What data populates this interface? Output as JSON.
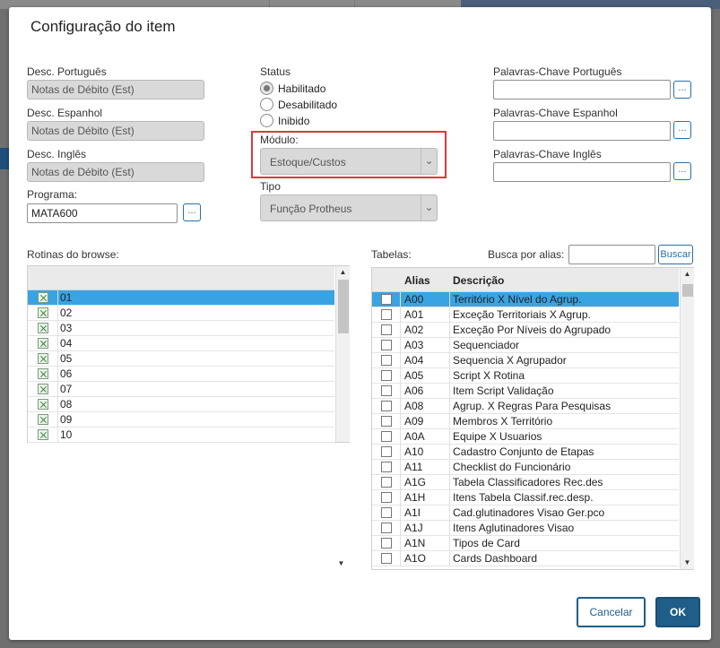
{
  "dialog": {
    "title": "Configuração do item"
  },
  "desc": {
    "pt_label": "Desc. Português",
    "pt_value": "Notas de Débito (Est)",
    "es_label": "Desc. Espanhol",
    "es_value": "Notas de Débito (Est)",
    "en_label": "Desc. Inglês",
    "en_value": "Notas de Débito (Est)"
  },
  "programa": {
    "label": "Programa:",
    "value": "MATA600",
    "lookup_label": "..."
  },
  "status": {
    "label": "Status",
    "options": [
      "Habilitado",
      "Desabilitado",
      "Inibido"
    ],
    "selected": "Habilitado"
  },
  "modulo": {
    "label": "Módulo:",
    "value": "Estoque/Custos"
  },
  "tipo": {
    "label": "Tipo",
    "value": "Função Protheus"
  },
  "keywords": {
    "pt_label": "Palavras-Chave Português",
    "es_label": "Palavras-Chave Espanhol",
    "en_label": "Palavras-Chave Inglês",
    "lookup_label": "..."
  },
  "browse": {
    "label": "Rotinas do browse:",
    "rows": [
      "01",
      "02",
      "03",
      "04",
      "05",
      "06",
      "07",
      "08",
      "09",
      "10"
    ]
  },
  "tables": {
    "label": "Tabelas:",
    "search_label": "Busca por alias:",
    "search_value": "",
    "search_button": "Buscar",
    "col_alias": "Alias",
    "col_desc": "Descrição",
    "rows": [
      {
        "alias": "A00",
        "desc": "Território X Nível do Agrup."
      },
      {
        "alias": "A01",
        "desc": "Exceção Territoriais X Agrup."
      },
      {
        "alias": "A02",
        "desc": "Exceção Por Níveis do Agrupado"
      },
      {
        "alias": "A03",
        "desc": "Sequenciador"
      },
      {
        "alias": "A04",
        "desc": "Sequencia X Agrupador"
      },
      {
        "alias": "A05",
        "desc": "Script X Rotina"
      },
      {
        "alias": "A06",
        "desc": "Item Script Validação"
      },
      {
        "alias": "A08",
        "desc": "Agrup. X Regras Para Pesquisas"
      },
      {
        "alias": "A09",
        "desc": "Membros X Território"
      },
      {
        "alias": "A0A",
        "desc": "Equipe X Usuarios"
      },
      {
        "alias": "A10",
        "desc": "Cadastro Conjunto de Etapas"
      },
      {
        "alias": "A11",
        "desc": "Checklist do Funcionário"
      },
      {
        "alias": "A1G",
        "desc": "Tabela Classificadores Rec.des"
      },
      {
        "alias": "A1H",
        "desc": "Itens Tabela Classif.rec.desp."
      },
      {
        "alias": "A1I",
        "desc": "Cad.glutinadores Visao Ger.pco"
      },
      {
        "alias": "A1J",
        "desc": "Itens Aglutinadores Visao"
      },
      {
        "alias": "A1N",
        "desc": "Tipos de Card"
      },
      {
        "alias": "A1O",
        "desc": "Cards Dashboard"
      }
    ]
  },
  "actions": {
    "cancel": "Cancelar",
    "ok": "OK"
  },
  "colors": {
    "accent": "#1f5e89",
    "selection": "#3aa3e3",
    "highlight": "#d83a3a"
  }
}
